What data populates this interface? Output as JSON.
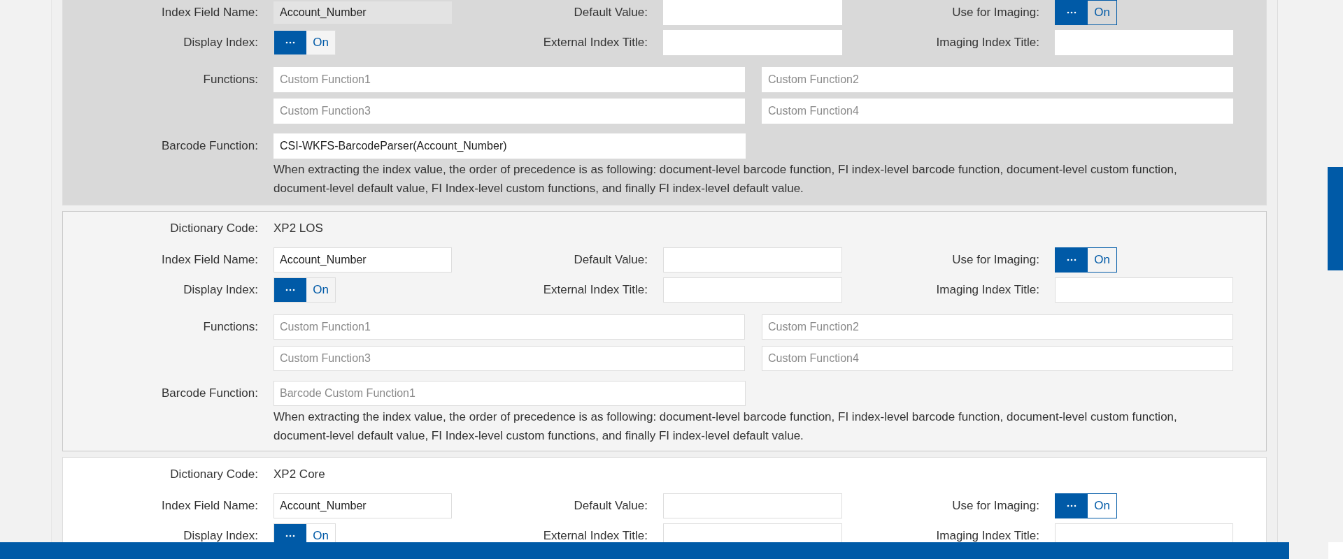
{
  "cards": [
    {
      "selected": true,
      "hovered": false,
      "index_field_name": {
        "label": "Index Field Name:",
        "value": "Account_Number",
        "readonly": true
      },
      "default_value": {
        "label": "Default Value:"
      },
      "use_for_imaging": {
        "label": "Use for Imaging:",
        "on": true,
        "text": "On"
      },
      "display_index": {
        "label": "Display Index:",
        "on": true,
        "text": "On"
      },
      "external_index_title": {
        "label": "External Index Title:"
      },
      "imaging_index_title": {
        "label": "Imaging Index Title:"
      },
      "functions": {
        "label": "Functions:",
        "fields": [
          {
            "placeholder": "Custom Function1"
          },
          {
            "placeholder": "Custom Function2"
          },
          {
            "placeholder": "Custom Function3"
          },
          {
            "placeholder": "Custom Function4"
          }
        ]
      },
      "barcode_function": {
        "label": "Barcode Function:",
        "value": "CSI-WKFS-BarcodeParser(Account_Number)"
      },
      "note": "When extracting the index value, the order of precedence is as following: document-level barcode function, FI index-level barcode function, document-level custom function, document-level default value, FI Index-level custom functions, and finally FI index-level default value."
    },
    {
      "selected": false,
      "hovered": true,
      "dictionary_code": {
        "label": "Dictionary Code:",
        "value": "XP2 LOS"
      },
      "index_field_name": {
        "label": "Index Field Name:",
        "value": "Account_Number",
        "readonly": false
      },
      "default_value": {
        "label": "Default Value:"
      },
      "use_for_imaging": {
        "label": "Use for Imaging:",
        "on": true,
        "text": "On"
      },
      "display_index": {
        "label": "Display Index:",
        "on": true,
        "text": "On"
      },
      "external_index_title": {
        "label": "External Index Title:"
      },
      "imaging_index_title": {
        "label": "Imaging Index Title:"
      },
      "functions": {
        "label": "Functions:",
        "fields": [
          {
            "placeholder": "Custom Function1"
          },
          {
            "placeholder": "Custom Function2"
          },
          {
            "placeholder": "Custom Function3"
          },
          {
            "placeholder": "Custom Function4"
          }
        ]
      },
      "barcode_function": {
        "label": "Barcode Function:",
        "placeholder": "Barcode Custom Function1"
      },
      "note": "When extracting the index value, the order of precedence is as following: document-level barcode function, FI index-level barcode function, document-level custom function, document-level default value, FI Index-level custom functions, and finally FI index-level default value."
    },
    {
      "selected": false,
      "hovered": false,
      "dictionary_code": {
        "label": "Dictionary Code:",
        "value": "XP2 Core"
      },
      "index_field_name": {
        "label": "Index Field Name:",
        "value": "Account_Number",
        "readonly": false
      },
      "default_value": {
        "label": "Default Value:"
      },
      "use_for_imaging": {
        "label": "Use for Imaging:",
        "on": true,
        "text": "On"
      },
      "display_index": {
        "label": "Display Index:",
        "on": true,
        "text": "On"
      },
      "external_index_title": {
        "label": "External Index Title:"
      },
      "imaging_index_title": {
        "label": "Imaging Index Title:"
      }
    }
  ]
}
